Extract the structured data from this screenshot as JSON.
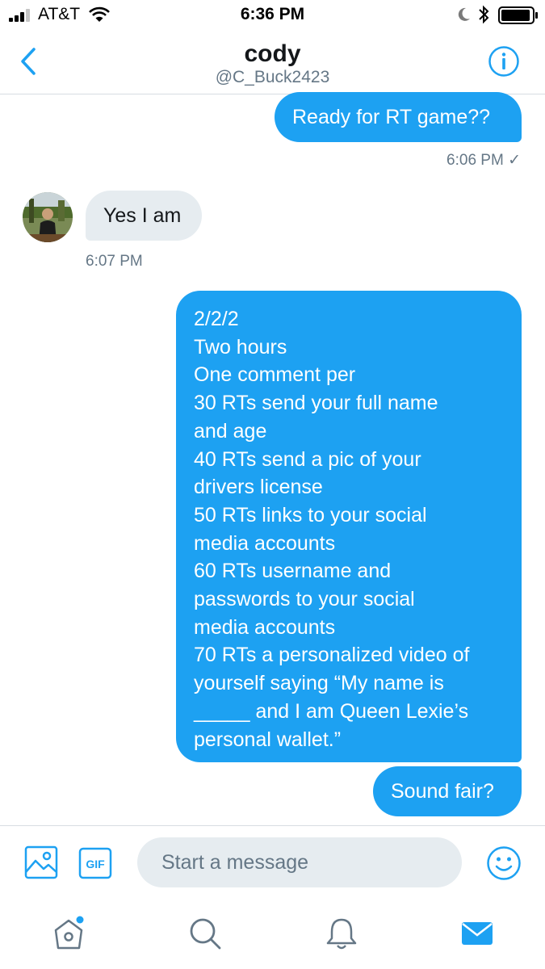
{
  "status_bar": {
    "carrier": "AT&T",
    "time": "6:36 PM",
    "signal_bars": 3,
    "battery_level": 0.95
  },
  "header": {
    "name": "cody",
    "handle": "@C_Buck2423",
    "icons": {
      "back": "chevron-left-icon",
      "info": "info-icon"
    }
  },
  "messages": [
    {
      "direction": "outgoing",
      "text": "Ready for RT game??"
    },
    {
      "direction": "outgoing",
      "timestamp": "6:06 PM",
      "status": "✓"
    },
    {
      "direction": "incoming",
      "text": "Yes I am",
      "timestamp": "6:07 PM"
    },
    {
      "direction": "outgoing",
      "lines": [
        "2/2/2",
        "Two hours",
        "One comment per",
        "30 RTs send your full name",
        "and age",
        "40 RTs send a pic of your",
        "drivers license",
        "50 RTs links to your social",
        "media accounts",
        "60 RTs username and",
        "passwords to your social",
        "media accounts",
        "70 RTs a personalized video of",
        "yourself saying “My name is",
        "_____ and I am Queen Lexie’s",
        "personal wallet.”"
      ]
    },
    {
      "direction": "outgoing",
      "text": "Sound fair?"
    }
  ],
  "composer": {
    "placeholder": "Start a message",
    "gif_label": "GIF",
    "icons": [
      "photo-icon",
      "gif-icon",
      "emoji-icon"
    ]
  },
  "tabbar": {
    "tabs": [
      "home-icon",
      "search-icon",
      "notifications-icon",
      "messages-icon"
    ],
    "active": "messages-icon"
  },
  "colors": {
    "accent": "#1da1f2",
    "incoming_bubble": "#e6ecf0",
    "secondary_text": "#657786"
  }
}
